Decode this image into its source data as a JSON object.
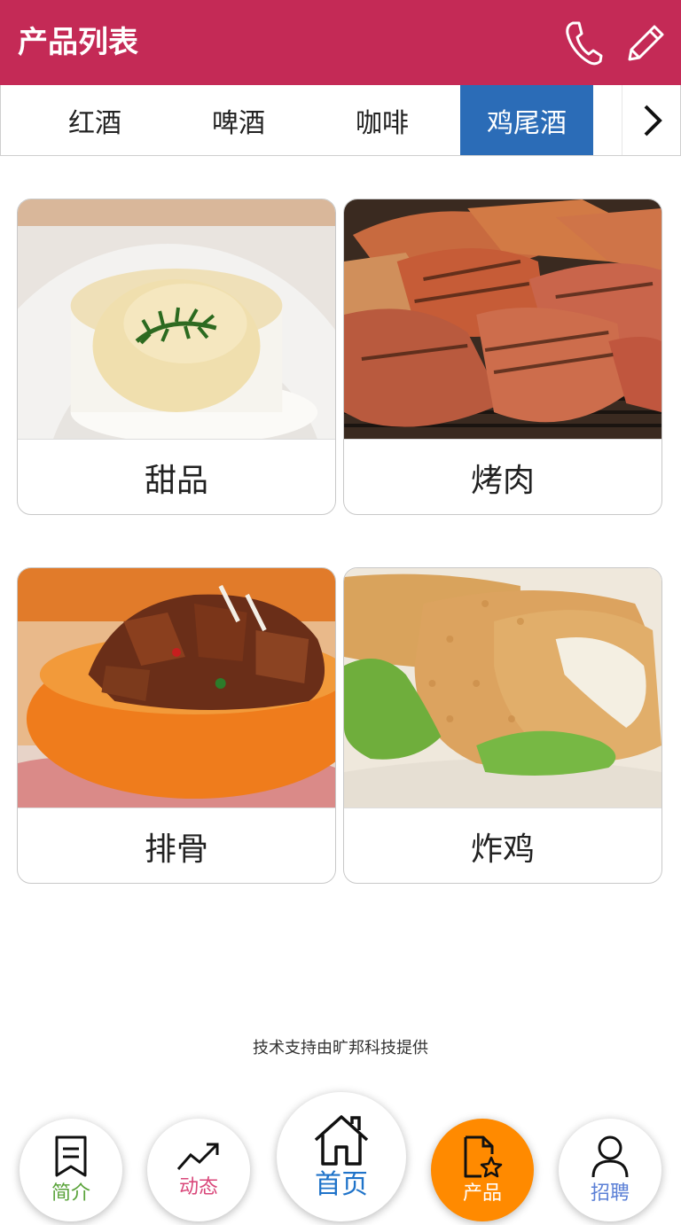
{
  "header": {
    "title": "产品列表"
  },
  "tabs": [
    {
      "label": "红酒"
    },
    {
      "label": "啤酒"
    },
    {
      "label": "咖啡"
    },
    {
      "label": "鸡尾酒",
      "active": true
    }
  ],
  "products": [
    {
      "label": "甜品"
    },
    {
      "label": "烤肉"
    },
    {
      "label": "排骨"
    },
    {
      "label": "炸鸡"
    }
  ],
  "footer": {
    "note": "技术支持由旷邦科技提供"
  },
  "bottom_nav": [
    {
      "label": "简介",
      "icon": "bookmark-icon",
      "color": "#5aa33a"
    },
    {
      "label": "动态",
      "icon": "trend-up-icon",
      "color": "#d9477a"
    },
    {
      "label": "首页",
      "icon": "home-icon",
      "color": "#1f73c9"
    },
    {
      "label": "产品",
      "icon": "document-star-icon",
      "color": "#ffffff",
      "active_bg": "#ff8a00"
    },
    {
      "label": "招聘",
      "icon": "user-icon",
      "color": "#5a7fd6"
    }
  ],
  "colors": {
    "header_bg": "#c42a56",
    "tab_active_bg": "#2b6cb7"
  }
}
